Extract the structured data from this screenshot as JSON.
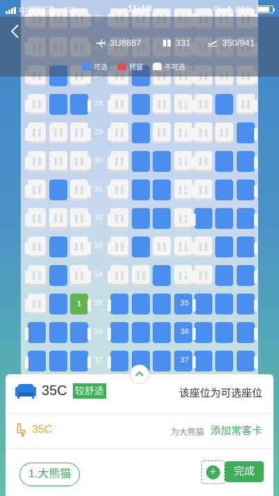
{
  "status_bar": {
    "carrier": "中国联通",
    "network": "4G",
    "time": "11:19",
    "battery": "81%"
  },
  "header": {
    "back_icon": "chevron-left-icon",
    "flight_no": "3U8887",
    "seats_count": "331",
    "aircraft": "350/941"
  },
  "legend": {
    "available": {
      "label": "可选",
      "color": "#4a8ff0"
    },
    "reserved": {
      "label": "预留",
      "color": "#e05050"
    },
    "unavailable": {
      "label": "不可选",
      "color": "#f4f4f4"
    }
  },
  "seat_rows": [
    {
      "num": "25",
      "left": [
        "n",
        "n",
        "n"
      ],
      "mid": [
        "n",
        "n",
        "n",
        "n"
      ],
      "right": [
        "n",
        "n",
        "n"
      ]
    },
    {
      "num": "26",
      "left": [
        "n",
        "n",
        "n"
      ],
      "mid": [
        "n",
        "n",
        "n",
        "n"
      ],
      "right": [
        "n",
        "n",
        "n"
      ]
    },
    {
      "num": "27",
      "left": [
        "n",
        "a",
        "n"
      ],
      "mid": [
        "n",
        "a",
        "n",
        "n"
      ],
      "right": [
        "n",
        "n",
        "n"
      ]
    },
    {
      "num": "28",
      "left": [
        "n",
        "a",
        "a"
      ],
      "mid": [
        "n",
        "a",
        "n",
        "n"
      ],
      "right": [
        "n",
        "a",
        "n"
      ]
    },
    {
      "num": "29",
      "left": [
        "n",
        "n",
        "n"
      ],
      "mid": [
        "n",
        "a",
        "n",
        "n"
      ],
      "right": [
        "n",
        "n",
        "a"
      ]
    },
    {
      "num": "30",
      "left": [
        "n",
        "n",
        "n"
      ],
      "mid": [
        "n",
        "a",
        "a",
        "n"
      ],
      "right": [
        "n",
        "a",
        "a"
      ]
    },
    {
      "num": "31",
      "left": [
        "n",
        "a",
        "n"
      ],
      "mid": [
        "n",
        "a",
        "a",
        "n"
      ],
      "right": [
        "n",
        "a",
        "a"
      ]
    },
    {
      "num": "32",
      "left": [
        "n",
        "n",
        "n"
      ],
      "mid": [
        "n",
        "a",
        "a",
        "n"
      ],
      "right": [
        "a",
        "a",
        "a"
      ]
    },
    {
      "num": "33",
      "left": [
        "n",
        "a",
        "n"
      ],
      "mid": [
        "n",
        "a",
        "n",
        "n"
      ],
      "right": [
        "n",
        "a",
        "a"
      ]
    },
    {
      "num": "34",
      "left": [
        "n",
        "a",
        "n"
      ],
      "mid": [
        "n",
        "n",
        "a",
        "n"
      ],
      "right": [
        "n",
        "a",
        "a"
      ]
    },
    {
      "num": "35",
      "left": [
        "n",
        "a",
        "s"
      ],
      "mid": [
        "a",
        "a",
        "a",
        "a"
      ],
      "right": [
        "a",
        "a",
        "a"
      ]
    },
    {
      "num": "36",
      "left": [
        "a",
        "a",
        "a"
      ],
      "mid": [
        "a",
        "a",
        "a",
        "a"
      ],
      "right": [
        "a",
        "a",
        "a"
      ]
    },
    {
      "num": "37",
      "left": [
        "a",
        "a",
        "a"
      ],
      "mid": [
        "a",
        "a",
        "a",
        "a"
      ],
      "right": [
        "a",
        "a",
        "a"
      ]
    }
  ],
  "selected_seat_marker": "1",
  "panel": {
    "seat_icon": "sofa-icon",
    "seat_code": "35C",
    "comfort_badge": "较舒适",
    "seat_status": "该座位为可选座位",
    "passenger_seat": "35C",
    "passenger_seat_icon": "seat-icon",
    "for_name": "为大熊猫",
    "add_card": "添加常客卡",
    "passenger_chip": "1.大熊猫",
    "done": "完成"
  }
}
